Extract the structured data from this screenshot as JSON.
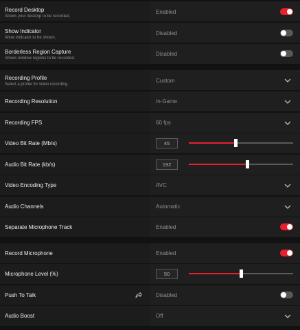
{
  "rows": {
    "record_desktop": {
      "label": "Record Desktop",
      "desc": "Allows your desktop to be recorded.",
      "value": "Enabled",
      "toggle": "on"
    },
    "show_indicator": {
      "label": "Show Indicator",
      "desc": "Allow indicator to be shown.",
      "value": "Disabled",
      "toggle": "off"
    },
    "borderless_capture": {
      "label": "Borderless Region Capture",
      "desc": "Allows window regions to be recorded.",
      "value": "Disabled",
      "toggle": "off"
    },
    "recording_profile": {
      "label": "Recording Profile",
      "desc": "Select a profile for video recording.",
      "value": "Custom"
    },
    "recording_resolution": {
      "label": "Recording Resolution",
      "value": "In-Game"
    },
    "recording_fps": {
      "label": "Recording FPS",
      "value": "60 fps"
    },
    "video_bit_rate": {
      "label": "Video Bit Rate (Mb/s)",
      "value": "45",
      "level": 0.45
    },
    "audio_bit_rate": {
      "label": "Audio Bit Rate (kb/s)",
      "value": "192",
      "level": 0.56
    },
    "video_encoding": {
      "label": "Video Encoding Type",
      "value": "AVC"
    },
    "audio_channels": {
      "label": "Audio Channels",
      "value": "Automatic"
    },
    "separate_mic_track": {
      "label": "Separate Microphone Track",
      "value": "Enabled",
      "toggle": "on"
    },
    "record_microphone": {
      "label": "Record Microphone",
      "value": "Enabled",
      "toggle": "on"
    },
    "microphone_level": {
      "label": "Microphone Level (%)",
      "value": "50",
      "level": 0.5
    },
    "push_to_talk": {
      "label": "Push To Talk",
      "value": "Disabled",
      "toggle": "off"
    },
    "audio_boost": {
      "label": "Audio Boost",
      "value": "Off"
    }
  },
  "icons": {
    "dropdown": "chevron-down-icon",
    "external": "share-arrow-icon"
  },
  "colors": {
    "accent": "#e8202d",
    "background": "#121212",
    "row": "#1c1c1c"
  }
}
